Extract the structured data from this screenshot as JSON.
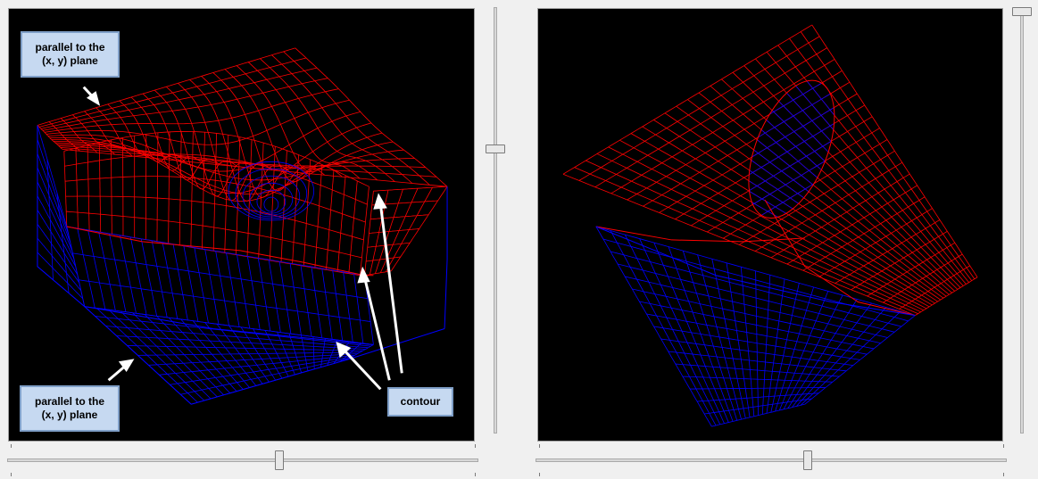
{
  "callouts": {
    "top_left": {
      "line1": "parallel to the",
      "line2": "(x, y) plane"
    },
    "bottom_left": {
      "line1": "parallel to the",
      "line2": "(x, y) plane"
    },
    "contour": "contour"
  },
  "colors": {
    "surface_upper": "#ff0000",
    "surface_lower": "#0000ff",
    "background": "#000000",
    "callout_fill": "#c6d9f1",
    "callout_border": "#7f9fc8",
    "arrow": "#ffffff"
  },
  "sliders": {
    "left_vertical_value": 0.33,
    "left_horizontal_value": 0.58,
    "right_vertical_value": 0.0,
    "right_horizontal_value": 0.58
  }
}
